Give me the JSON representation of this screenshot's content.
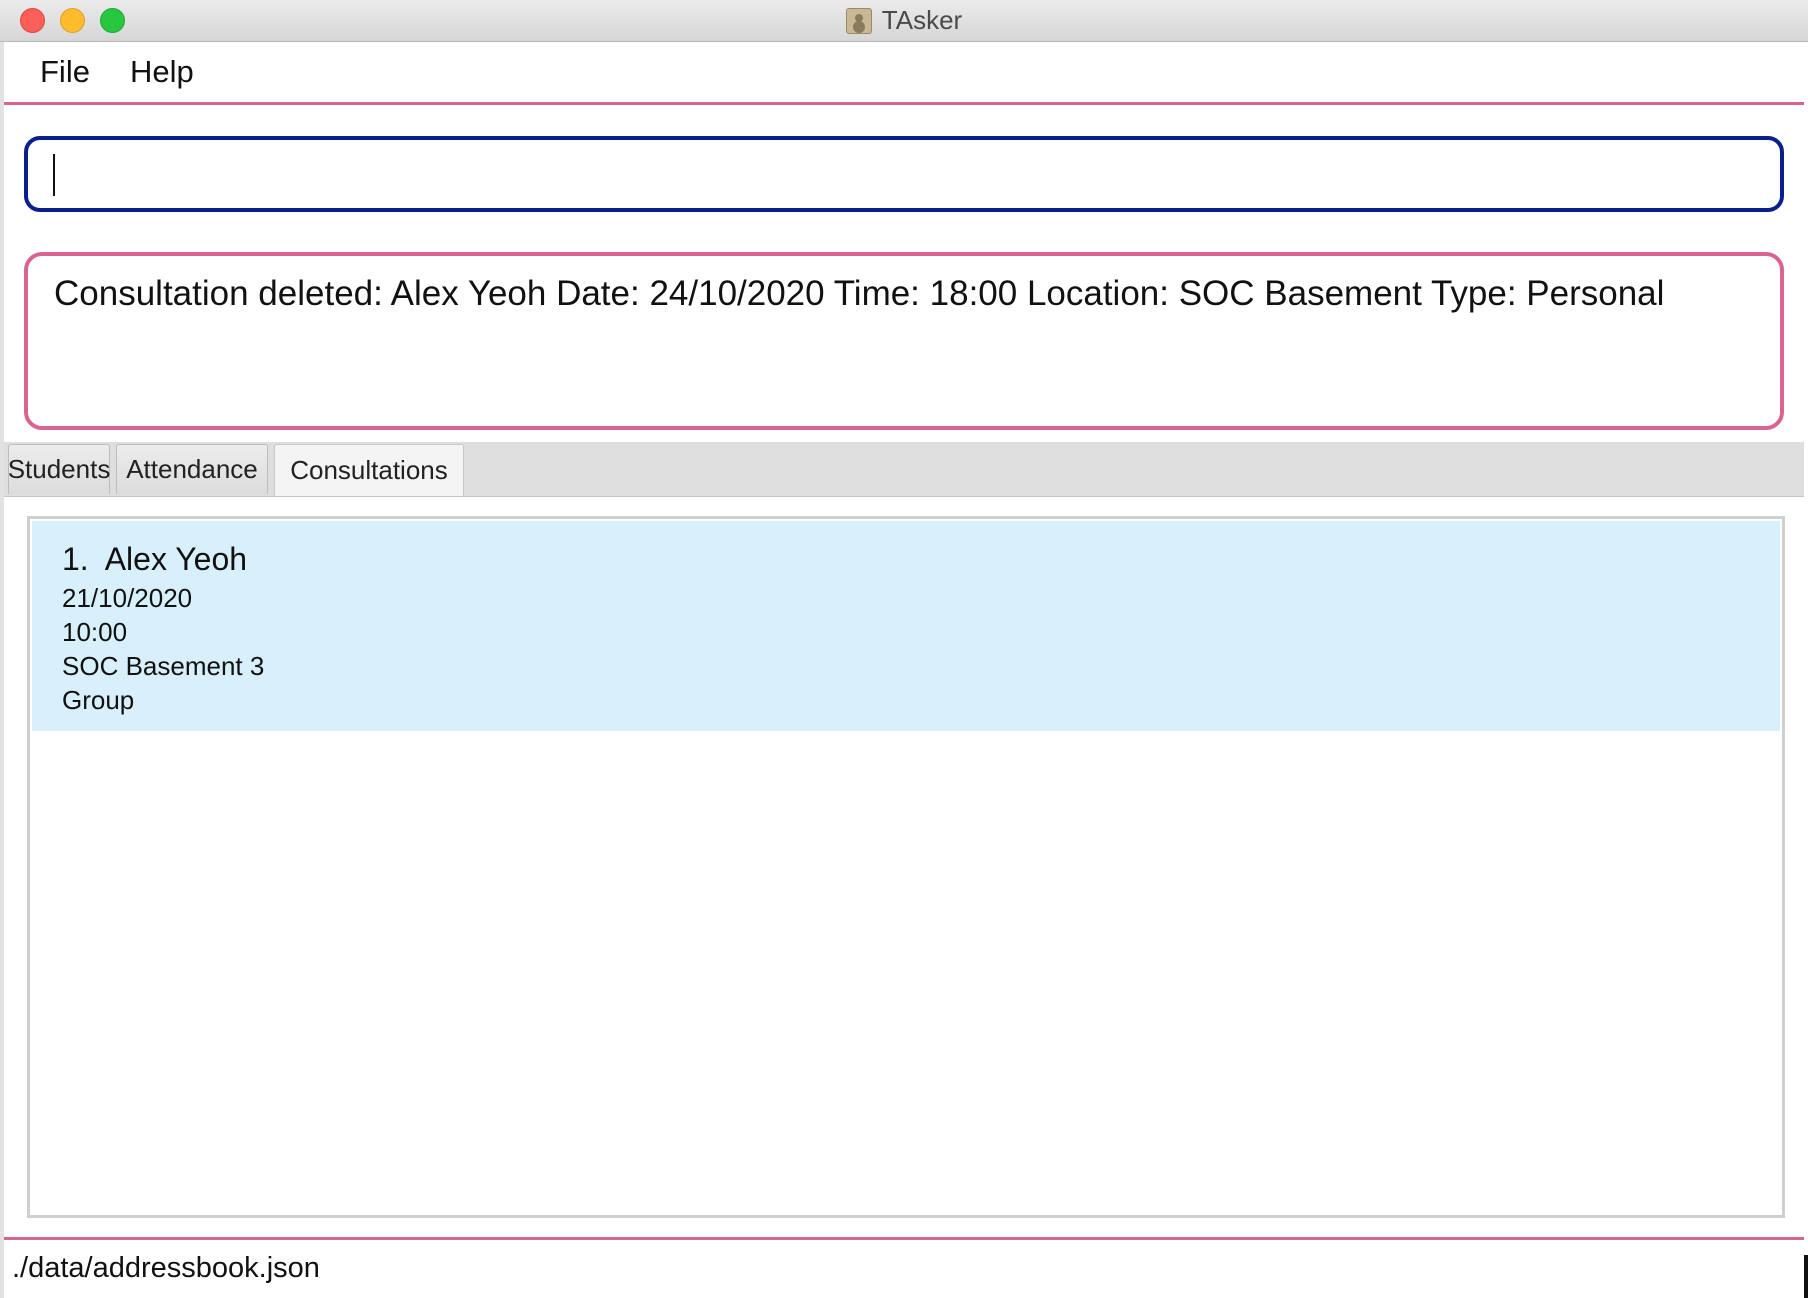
{
  "window": {
    "title": "TAsker"
  },
  "menu": {
    "items": [
      "File",
      "Help"
    ]
  },
  "command": {
    "value": "",
    "placeholder": ""
  },
  "result": {
    "text": "Consultation deleted: Alex Yeoh Date: 24/10/2020 Time: 18:00 Location: SOC Basement Type: Personal"
  },
  "tabs": [
    {
      "label": "Students",
      "active": false
    },
    {
      "label": "Attendance",
      "active": false
    },
    {
      "label": "Consultations",
      "active": true
    }
  ],
  "consultations": [
    {
      "index": "1.",
      "name": "Alex Yeoh",
      "date": "21/10/2020",
      "time": "10:00",
      "location": "SOC Basement 3",
      "type": "Group"
    }
  ],
  "status": {
    "path": "./data/addressbook.json"
  },
  "colors": {
    "accent_pink": "#d86490",
    "command_border": "#0a1e8c",
    "selected_row": "#d8f0fc"
  }
}
